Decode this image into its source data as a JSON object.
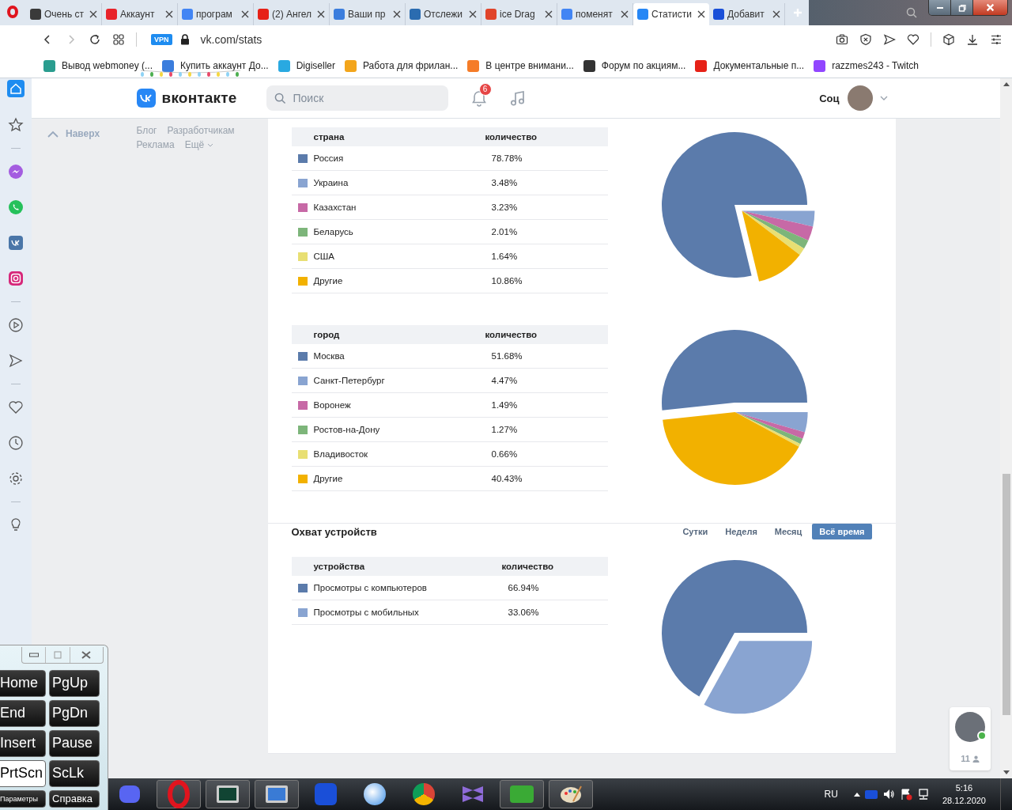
{
  "browser": {
    "tabs": [
      {
        "title": "Очень ст",
        "selected": false
      },
      {
        "title": "Аккаунт",
        "selected": false
      },
      {
        "title": "програм",
        "selected": false
      },
      {
        "title": "(2) Ангел",
        "selected": false
      },
      {
        "title": "Ваши пр",
        "selected": false
      },
      {
        "title": "Отслежи",
        "selected": false
      },
      {
        "title": "ice Drag",
        "selected": false
      },
      {
        "title": "поменят",
        "selected": false
      },
      {
        "title": "Статисти",
        "selected": true
      },
      {
        "title": "Добавит",
        "selected": false
      }
    ],
    "vpn": "VPN",
    "url": "vk.com/stats",
    "bookmarks": [
      "Вывод webmoney (...",
      "Купить аккаунт До...",
      "Digiseller",
      "Работа для фрилан...",
      "В центре внимани...",
      "Форум по акциям...",
      "Документальные п...",
      "razzmes243 - Twitch"
    ]
  },
  "header": {
    "logo": "вконтакте",
    "search": {
      "placeholder": "Поиск"
    },
    "notifications": "6",
    "user": "Соц"
  },
  "left_nav": {
    "up": "Наверх",
    "links": [
      "Блог",
      "Разработчикам",
      "Реклама",
      "Ещё"
    ]
  },
  "sections": [
    {
      "table": {
        "columns": [
          "страна",
          "количество"
        ],
        "rows": [
          {
            "name": "Россия",
            "value": "78.78%",
            "color": "#5b7bab"
          },
          {
            "name": "Украина",
            "value": "3.48%",
            "color": "#89a4d1"
          },
          {
            "name": "Казахстан",
            "value": "3.23%",
            "color": "#c769a6"
          },
          {
            "name": "Беларусь",
            "value": "2.01%",
            "color": "#7db57a"
          },
          {
            "name": "США",
            "value": "1.64%",
            "color": "#e8df73"
          },
          {
            "name": "Другие",
            "value": "10.86%",
            "color": "#f2b100"
          }
        ]
      },
      "chart_data": {
        "type": "pie",
        "values": [
          78.78,
          3.48,
          3.23,
          2.01,
          1.64,
          10.86
        ]
      }
    },
    {
      "table": {
        "columns": [
          "город",
          "количество"
        ],
        "rows": [
          {
            "name": "Москва",
            "value": "51.68%",
            "color": "#5b7bab"
          },
          {
            "name": "Санкт-Петербург",
            "value": "4.47%",
            "color": "#89a4d1"
          },
          {
            "name": "Воронеж",
            "value": "1.49%",
            "color": "#c769a6"
          },
          {
            "name": "Ростов-на-Дону",
            "value": "1.27%",
            "color": "#7db57a"
          },
          {
            "name": "Владивосток",
            "value": "0.66%",
            "color": "#e8df73"
          },
          {
            "name": "Другие",
            "value": "40.43%",
            "color": "#f2b100"
          }
        ]
      },
      "chart_data": {
        "type": "pie",
        "values": [
          51.68,
          4.47,
          1.49,
          1.27,
          0.66,
          40.43
        ]
      }
    },
    {
      "title": "Охват устройств",
      "periods": [
        {
          "label": "Сутки",
          "selected": false
        },
        {
          "label": "Неделя",
          "selected": false
        },
        {
          "label": "Месяц",
          "selected": false
        },
        {
          "label": "Всё время",
          "selected": true
        }
      ],
      "table": {
        "columns": [
          "устройства",
          "количество"
        ],
        "rows": [
          {
            "name": "Просмотры с компьютеров",
            "value": "66.94%",
            "color": "#5b7bab"
          },
          {
            "name": "Просмотры с мобильных",
            "value": "33.06%",
            "color": "#89a4d1"
          }
        ]
      },
      "chart_data": {
        "type": "pie",
        "values": [
          66.94,
          33.06
        ]
      }
    }
  ],
  "keyboard": {
    "keys": [
      {
        "label": "Home",
        "pressed": false
      },
      {
        "label": "PgUp",
        "pressed": false
      },
      {
        "label": "End",
        "pressed": false
      },
      {
        "label": "PgDn",
        "pressed": false
      },
      {
        "label": "Insert",
        "pressed": false
      },
      {
        "label": "Pause",
        "pressed": false
      },
      {
        "label": "PrtScn",
        "pressed": true
      },
      {
        "label": "ScLk",
        "pressed": false
      }
    ],
    "options": [
      "Параметры",
      "Справка"
    ]
  },
  "chat": {
    "count": "11"
  },
  "taskbar": {
    "language": "RU",
    "time": "5:16",
    "date": "28.12.2020"
  }
}
